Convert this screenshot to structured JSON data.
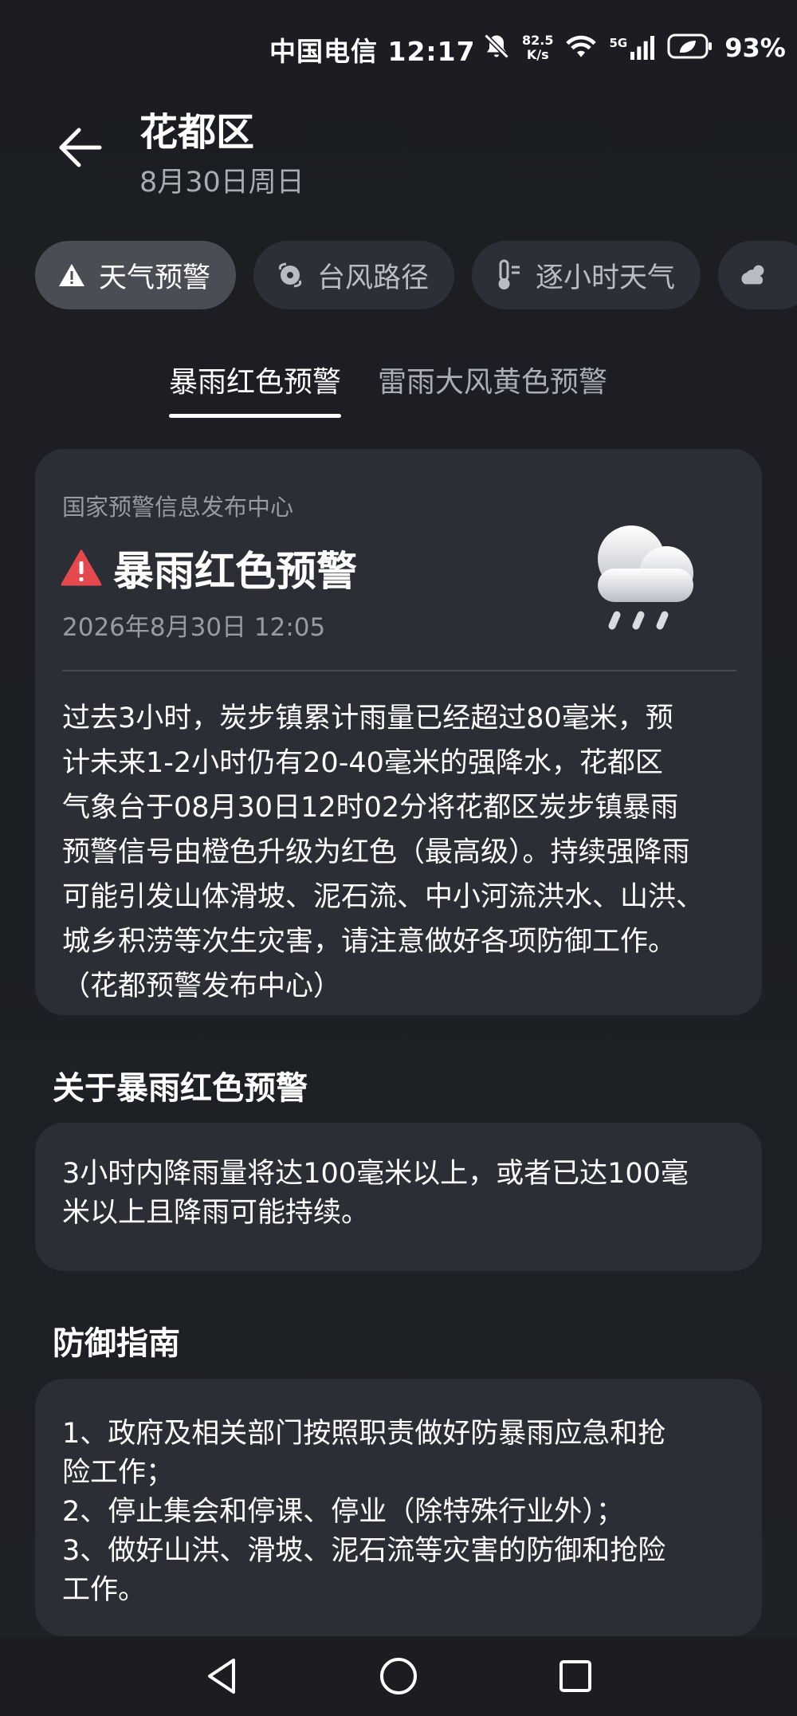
{
  "status_bar": {
    "carrier_time": "中国电信 12:17",
    "net_speed_value": "82.5",
    "net_speed_unit": "K/s",
    "signal_label": "5G",
    "battery": "93%"
  },
  "header": {
    "title": "花都区",
    "date": "8月30日周日"
  },
  "chips": [
    {
      "label": "天气预警",
      "icon": "warning-triangle-icon",
      "active": true
    },
    {
      "label": "台风路径",
      "icon": "typhoon-icon",
      "active": false
    },
    {
      "label": "逐小时天气",
      "icon": "thermometer-icon",
      "active": false
    },
    {
      "label": "",
      "icon": "partly-cloudy-icon",
      "active": false
    }
  ],
  "tabs": [
    {
      "label": "暴雨红色预警",
      "active": true
    },
    {
      "label": "雷雨大风黄色预警",
      "active": false
    }
  ],
  "alert": {
    "source": "国家预警信息发布中心",
    "title": "暴雨红色预警",
    "time": "2026年8月30日 12:05",
    "body_lines": [
      "过去3小时，炭步镇累计雨量已经超过80毫米，预",
      "计未来1-2小时仍有20-40毫米的强降水，花都区",
      "气象台于08月30日12时02分将花都区炭步镇暴雨",
      "预警信号由橙色升级为红色（最高级）。持续强降雨",
      "可能引发山体滑坡、泥石流、中小河流洪水、山洪、",
      "城乡积涝等次生灾害，请注意做好各项防御工作。",
      "（花都预警发布中心）"
    ],
    "icon": "rain-cloud-icon",
    "warning_color": "#e5484d"
  },
  "about": {
    "title": "关于暴雨红色预警",
    "lines": [
      "3小时内降雨量将达100毫米以上，或者已达100毫",
      "米以上且降雨可能持续。"
    ]
  },
  "guide": {
    "title": "防御指南",
    "lines": [
      "1、政府及相关部门按照职责做好防暴雨应急和抢",
      "险工作；",
      "2、停止集会和停课、停业（除特殊行业外）；",
      "3、做好山洪、滑坡、泥石流等灾害的防御和抢险",
      "工作。"
    ]
  },
  "nav": {
    "back": "back-triangle-icon",
    "home": "home-circle-icon",
    "recent": "recent-square-icon"
  }
}
